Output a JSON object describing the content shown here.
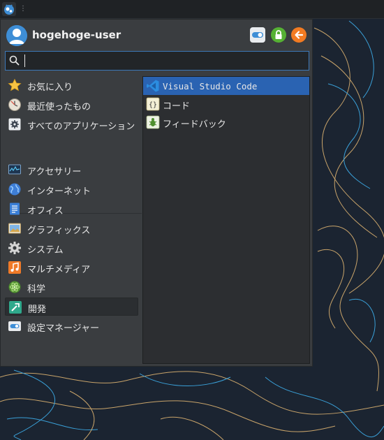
{
  "panel": {
    "handle_glyph": "⋮"
  },
  "header": {
    "username": "hogehoge-user",
    "buttons": [
      {
        "name": "settings-manager",
        "icon": "toggle-icon"
      },
      {
        "name": "lock-screen",
        "icon": "lock-icon"
      },
      {
        "name": "log-out",
        "icon": "arrow-left-icon"
      }
    ]
  },
  "search": {
    "placeholder": "",
    "value": ""
  },
  "categories": [
    {
      "label": "お気に入り",
      "icon": "star-icon",
      "selected": false
    },
    {
      "label": "最近使ったもの",
      "icon": "clock-icon",
      "selected": false
    },
    {
      "label": "すべてのアプリケーション",
      "icon": "gear-box-icon",
      "selected": false
    },
    {
      "label": "アクセサリー",
      "icon": "monitor-icon",
      "selected": false
    },
    {
      "label": "インターネット",
      "icon": "globe-icon",
      "selected": false
    },
    {
      "label": "オフィス",
      "icon": "document-icon",
      "selected": false
    },
    {
      "label": "グラフィックス",
      "icon": "picture-icon",
      "selected": false
    },
    {
      "label": "システム",
      "icon": "gear-icon",
      "selected": false
    },
    {
      "label": "マルチメディア",
      "icon": "music-note-icon",
      "selected": false
    },
    {
      "label": "科学",
      "icon": "atom-icon",
      "selected": false
    },
    {
      "label": "開発",
      "icon": "hammer-icon",
      "selected": true
    },
    {
      "label": "設定マネージャー",
      "icon": "toggle-icon",
      "selected": false
    }
  ],
  "apps": [
    {
      "label": "Visual Studio Code",
      "icon": "vscode-icon",
      "selected": true
    },
    {
      "label": "コード",
      "icon": "braces-icon",
      "selected": false
    },
    {
      "label": "フィードバック",
      "icon": "bug-icon",
      "selected": false
    }
  ],
  "colors": {
    "accent": "#2a63b2",
    "menu_bg": "#3a3d40",
    "panel_bg": "#2c2e31",
    "wallpaper": "#1b2431"
  }
}
